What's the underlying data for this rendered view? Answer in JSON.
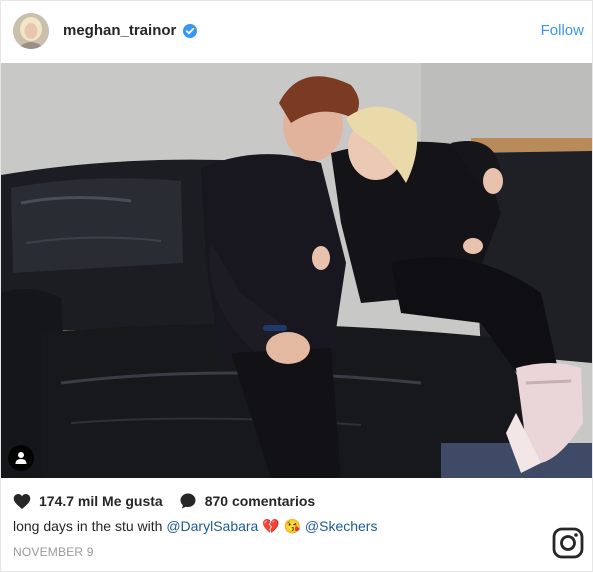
{
  "post": {
    "username": "meghan_trainor",
    "follow_label": "Follow",
    "likes_label": "174.7 mil Me gusta",
    "comments_label": "870 comentarios",
    "caption": {
      "text": "long days in the stu with",
      "mention1": "@DarylSabara",
      "emoji1": "💔",
      "emoji2": "😘",
      "mention2": "@Skechers"
    },
    "date": "NOVEMBER 9"
  },
  "icons": {
    "verified": "verified-badge-icon",
    "heart": "heart-icon",
    "comment": "comment-bubble-icon",
    "user_tag": "user-tag-icon",
    "instagram": "instagram-logo-icon"
  },
  "colors": {
    "link": "#3897f0",
    "mention": "#1d5b91",
    "verified": "#3897f0"
  }
}
